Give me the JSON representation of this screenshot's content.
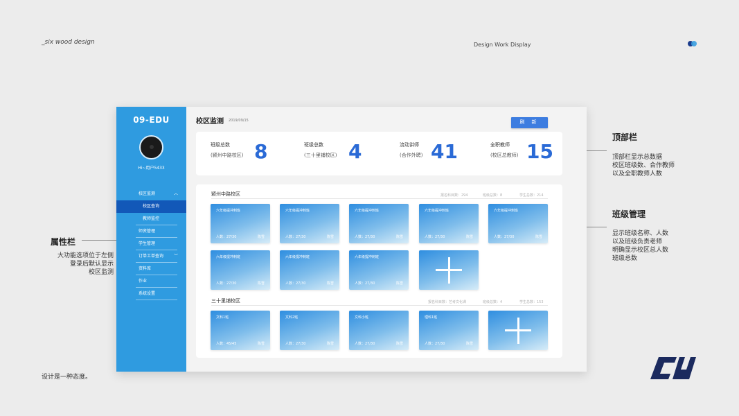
{
  "brand": "_six wood design",
  "showcase": "Design Work Display",
  "tagline": "设计是一种态度。",
  "colors": {
    "accent": "#2f9be0",
    "active": "#1258b8",
    "number": "#2a6ad6",
    "button": "#3d7de0"
  },
  "annotations": {
    "top": {
      "title": "顶部栏",
      "lines": [
        "顶部栏显示总数据",
        "校区班级数、合作教师",
        "以及全职教师人数"
      ]
    },
    "class_mgmt": {
      "title": "班级管理",
      "lines": [
        "显示班级名称、人数",
        "以及班级负责老师",
        "明确显示校区总人数",
        "班级总数"
      ]
    },
    "sidebar": {
      "title": "属性栏",
      "lines": [
        "大功能选项位于左侧",
        "登录后默认显示",
        "校区监测"
      ]
    }
  },
  "sidebar": {
    "title": "09-EDU",
    "username": "Hi~用户5433",
    "menu": [
      {
        "label": "校区监测",
        "caret": "︿"
      },
      {
        "label": "校区查询"
      },
      {
        "label": "教师监控"
      },
      {
        "label": "师资管理"
      },
      {
        "label": "学生管理"
      },
      {
        "label": "订单工单查询",
        "caret": "﹀"
      },
      {
        "label": "资料库"
      },
      {
        "label": "作业"
      },
      {
        "label": "系统设置"
      }
    ]
  },
  "header": {
    "title": "校区监测",
    "date": "2019/09/15",
    "refresh_label": "刷 新"
  },
  "stats": [
    {
      "label": "班级总数",
      "sub": "(颍州中路校区)",
      "value": "8"
    },
    {
      "label": "班级总数",
      "sub": "(三十里铺校区)",
      "value": "4"
    },
    {
      "label": "流动讲师",
      "sub": "(合作外聘)",
      "value": "41"
    },
    {
      "label": "全职教师",
      "sub": "(校区总教师)",
      "value": "15"
    }
  ],
  "campuses": [
    {
      "name": "颍州中路校区",
      "meta": [
        "报名科目数：294",
        "班级总数：8",
        "学生总数：214"
      ],
      "cards": [
        {
          "name": "六年级提冲刺班",
          "count": "人数：27/30",
          "teacher": "陈雪"
        },
        {
          "name": "六年级提冲刺班",
          "count": "人数：27/30",
          "teacher": "陈雪"
        },
        {
          "name": "六年级提冲刺班",
          "count": "人数：27/30",
          "teacher": "陈雪"
        },
        {
          "name": "六年级提冲刺班",
          "count": "人数：27/30",
          "teacher": "陈雪"
        },
        {
          "name": "六年级提冲刺班",
          "count": "人数：27/30",
          "teacher": "陈雪"
        },
        {
          "name": "六年级提冲刺班",
          "count": "人数：27/30",
          "teacher": "陈雪"
        },
        {
          "name": "六年级提冲刺班",
          "count": "人数：27/30",
          "teacher": "陈雪"
        },
        {
          "name": "六年级提冲刺班",
          "count": "人数：27/30",
          "teacher": "陈雪"
        }
      ]
    },
    {
      "name": "三十里铺校区",
      "meta": [
        "报名科目数：艺考文化课",
        "班级总数：4",
        "学生总数：153"
      ],
      "cards": [
        {
          "name": "文科1班",
          "count": "人数：45/45",
          "teacher": "陈雪"
        },
        {
          "name": "文科2班",
          "count": "人数：27/30",
          "teacher": "陈雪"
        },
        {
          "name": "文科小班",
          "count": "人数：27/30",
          "teacher": "陈雪"
        },
        {
          "name": "理科1班",
          "count": "人数：27/30",
          "teacher": "陈雪"
        }
      ]
    }
  ]
}
